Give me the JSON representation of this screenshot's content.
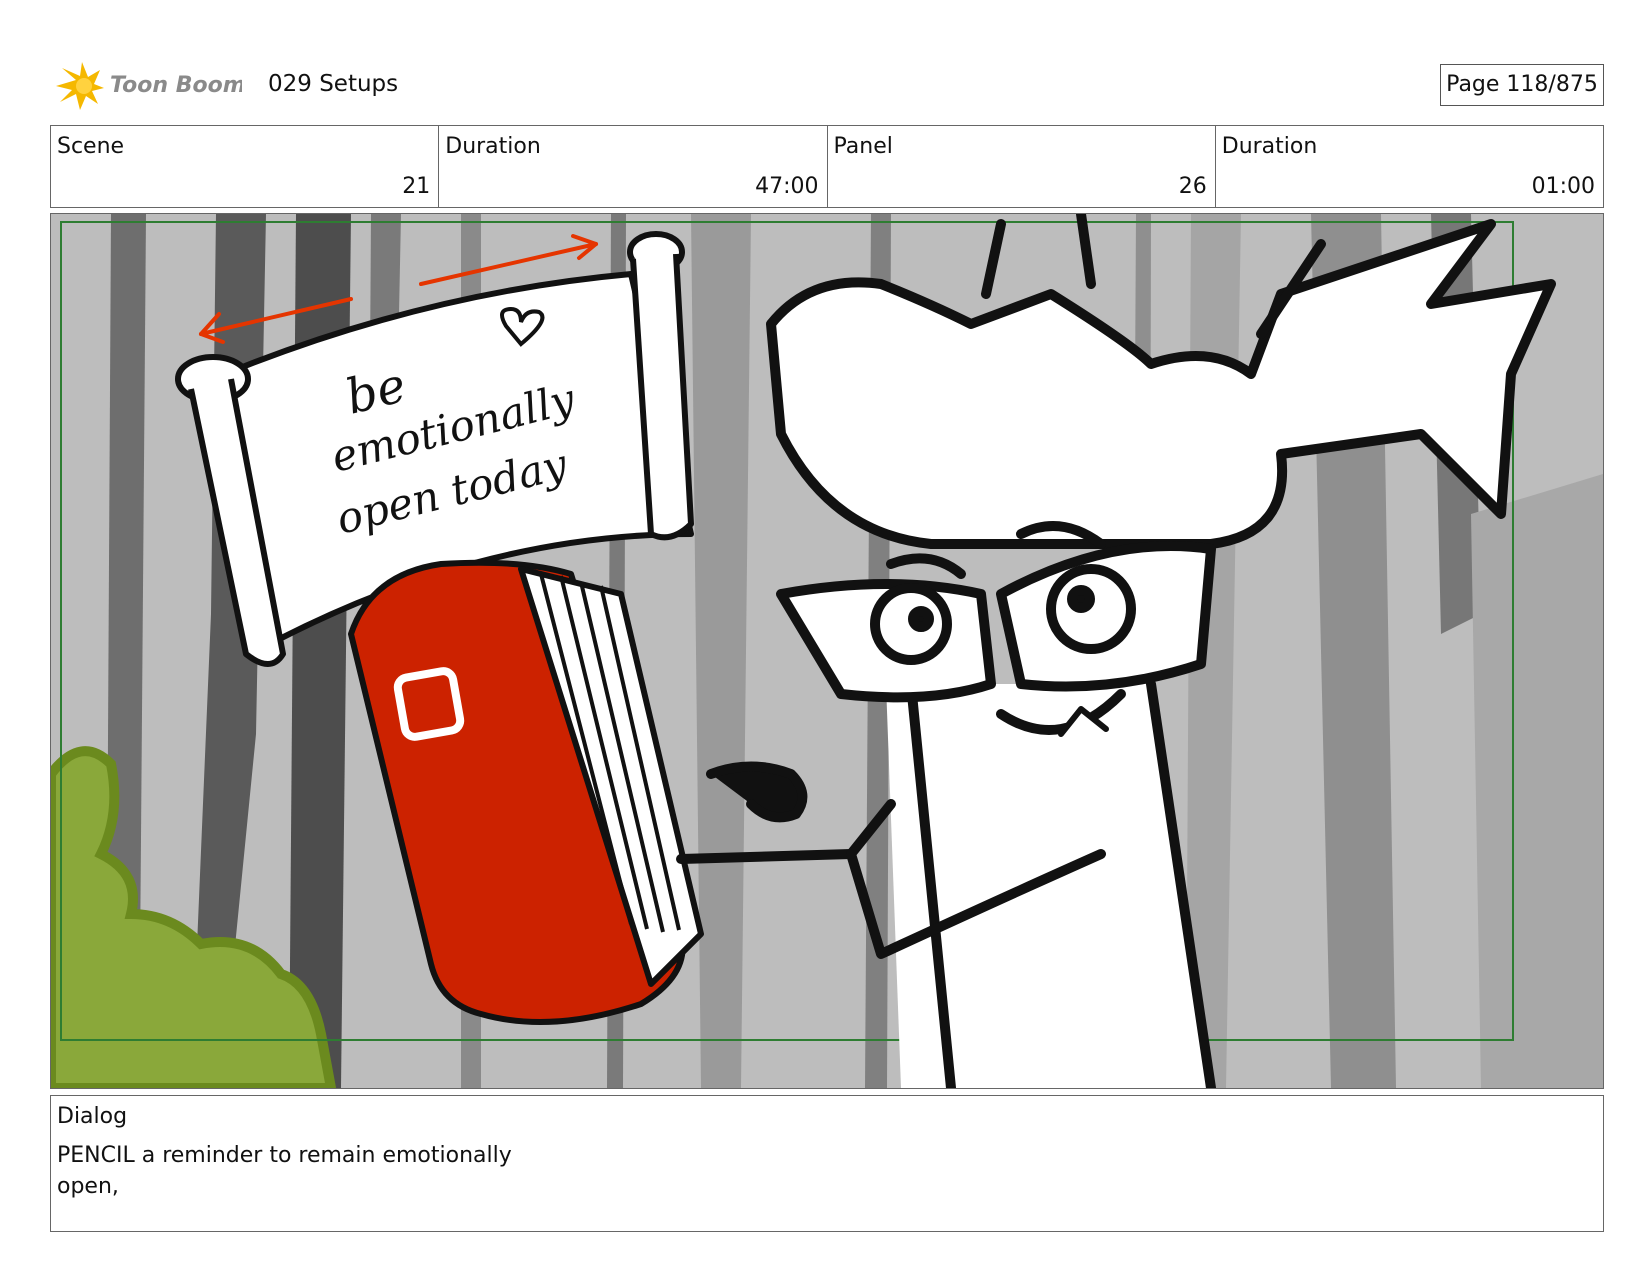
{
  "header": {
    "logo_text": "Toon Boom",
    "project_title": "029 Setups",
    "page_indicator": "Page 118/875"
  },
  "info": {
    "scene_label": "Scene",
    "scene_value": "21",
    "scene_duration_label": "Duration",
    "scene_duration_value": "47:00",
    "panel_label": "Panel",
    "panel_value": "26",
    "panel_duration_label": "Duration",
    "panel_duration_value": "01:00"
  },
  "panel": {
    "scroll_text": [
      "be",
      "emotionally",
      "open today"
    ]
  },
  "dialog": {
    "label": "Dialog",
    "text": "PENCIL  a reminder to remain emotionally open,"
  },
  "colors": {
    "accent_red": "#cc2200",
    "frame_green": "#2e7d32",
    "bush_green": "#8aa83a",
    "logo_yellow": "#f5b800"
  }
}
